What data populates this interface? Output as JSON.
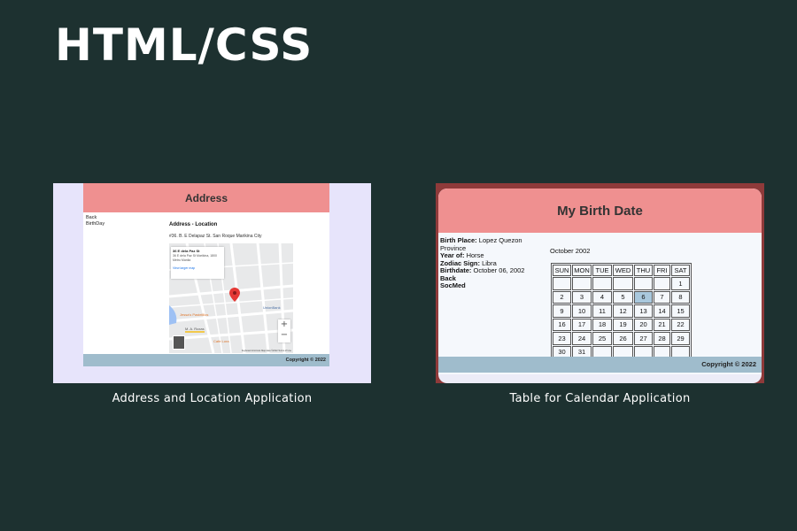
{
  "heading": "HTML/CSS",
  "projects": [
    {
      "caption": "Address and Location Application",
      "page": {
        "header": "Address",
        "nav": [
          "Back",
          "BirthDay"
        ],
        "section_title": "Address - Location",
        "address": "#36. B. E Delapaz St. San Roque Marikina City",
        "map": {
          "info_title": "36 E dela Paz St",
          "info_sub1": "36 E dela Paz St Marikina, 1800",
          "info_sub2": "Metro Manila",
          "info_link": "View larger map",
          "poi1": "Jessa's Pastelillos",
          "poi2": "M. A. Roxas",
          "poi3": "Cafe Lora",
          "poi4": "UnionBank",
          "zoom_in": "+",
          "zoom_out": "−",
          "footer": "Keyboard shortcuts   Map data ©2022   Terms of Use"
        },
        "footer": "Copyright © 2022"
      }
    },
    {
      "caption": "Table for Calendar Application",
      "page": {
        "header": "My Birth Date",
        "info": {
          "birth_place_label": "Birth Place:",
          "birth_place": " Lopez Quezon Province",
          "year_of_label": "Year of:",
          "year_of": " Horse",
          "zodiac_label": "Zodiac Sign:",
          "zodiac": " Libra",
          "birthdate_label": "Birthdate:",
          "birthdate": " October 06, 2002",
          "links": [
            "Back",
            "SocMed"
          ]
        },
        "month": "October 2002",
        "days": [
          "SUN",
          "MON",
          "TUE",
          "WED",
          "THU",
          "FRI",
          "SAT"
        ],
        "weeks": [
          [
            "",
            "",
            "",
            "",
            "",
            "",
            "1"
          ],
          [
            "2",
            "3",
            "4",
            "5",
            "6",
            "7",
            "8"
          ],
          [
            "9",
            "10",
            "11",
            "12",
            "13",
            "14",
            "15"
          ],
          [
            "16",
            "17",
            "18",
            "19",
            "20",
            "21",
            "22"
          ],
          [
            "23",
            "24",
            "25",
            "26",
            "27",
            "28",
            "29"
          ],
          [
            "30",
            "31",
            "",
            "",
            "",
            "",
            ""
          ]
        ],
        "highlight": "6",
        "footer": "Copyright © 2022"
      }
    }
  ],
  "colors": {
    "background": "#1d3130",
    "header_pink": "#ef9090",
    "footer_blue": "#9fbccc",
    "highlight": "#a9c8dd"
  }
}
